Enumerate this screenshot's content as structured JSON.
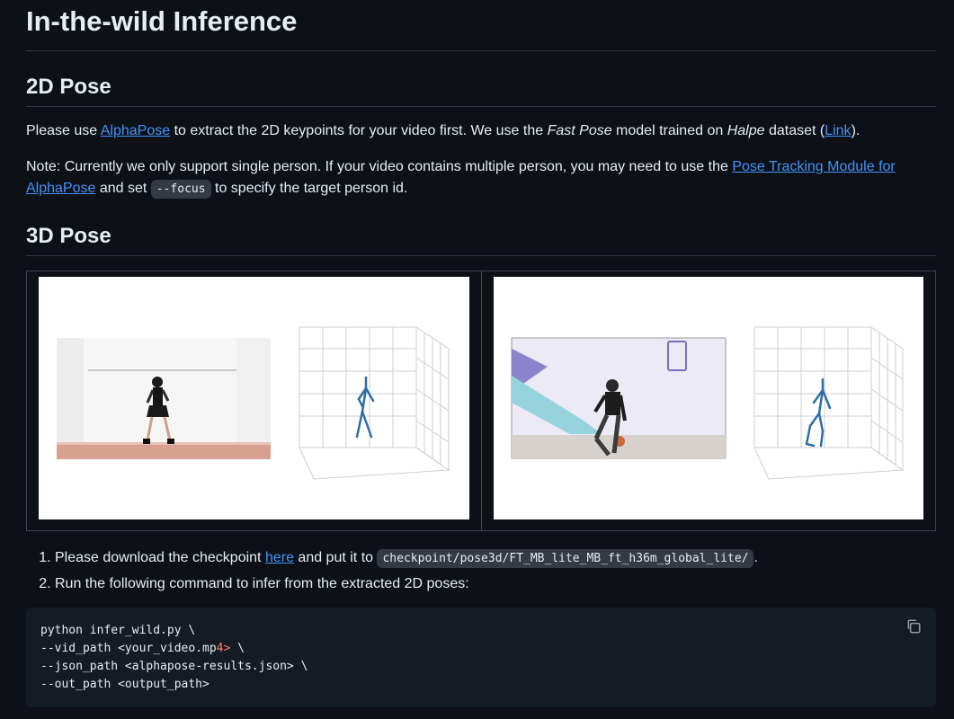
{
  "title": "In-the-wild Inference",
  "section_2d": {
    "heading": "2D Pose",
    "para1": {
      "t1": "Please use ",
      "link_alphapose": "AlphaPose",
      "t2": " to extract the 2D keypoints for your video first. We use the ",
      "em_fastpose": "Fast Pose",
      "t3": " model trained on ",
      "em_halpe": "Halpe",
      "t4": " dataset (",
      "link_link": "Link",
      "t5": ")."
    },
    "para2": {
      "t1": "Note: Currently we only support single person. If your video contains multiple person, you may need to use the ",
      "link_tracking": "Pose Tracking Module for AlphaPose",
      "t2": " and set ",
      "code_focus": "--focus",
      "t3": " to specify the target person id."
    }
  },
  "section_3d": {
    "heading": "3D Pose"
  },
  "steps": {
    "step1": {
      "t1": "Please download the checkpoint ",
      "link_here": "here",
      "t2": " and put it to ",
      "code_path": "checkpoint/pose3d/FT_MB_lite_MB_ft_h36m_global_lite/",
      "t3": "."
    },
    "step2": "Run the following command to infer from the extracted 2D poses:"
  },
  "code": {
    "l1": "python infer_wild.py \\",
    "l2a": "--vid_path ",
    "l2b": "<your_video.mp",
    "l2c": "4",
    "l2d": ">",
    "l2e": " \\",
    "l3a": "--json_path ",
    "l3b": "<alphapose-results.json>",
    "l3c": " \\",
    "l4a": "--out_path ",
    "l4b": "<output_path>"
  },
  "icons": {
    "copy": "copy-icon"
  },
  "colors": {
    "link": "#4493f8",
    "background": "#0d1117",
    "code_bg": "#151b23",
    "string": "#ff7b72"
  }
}
